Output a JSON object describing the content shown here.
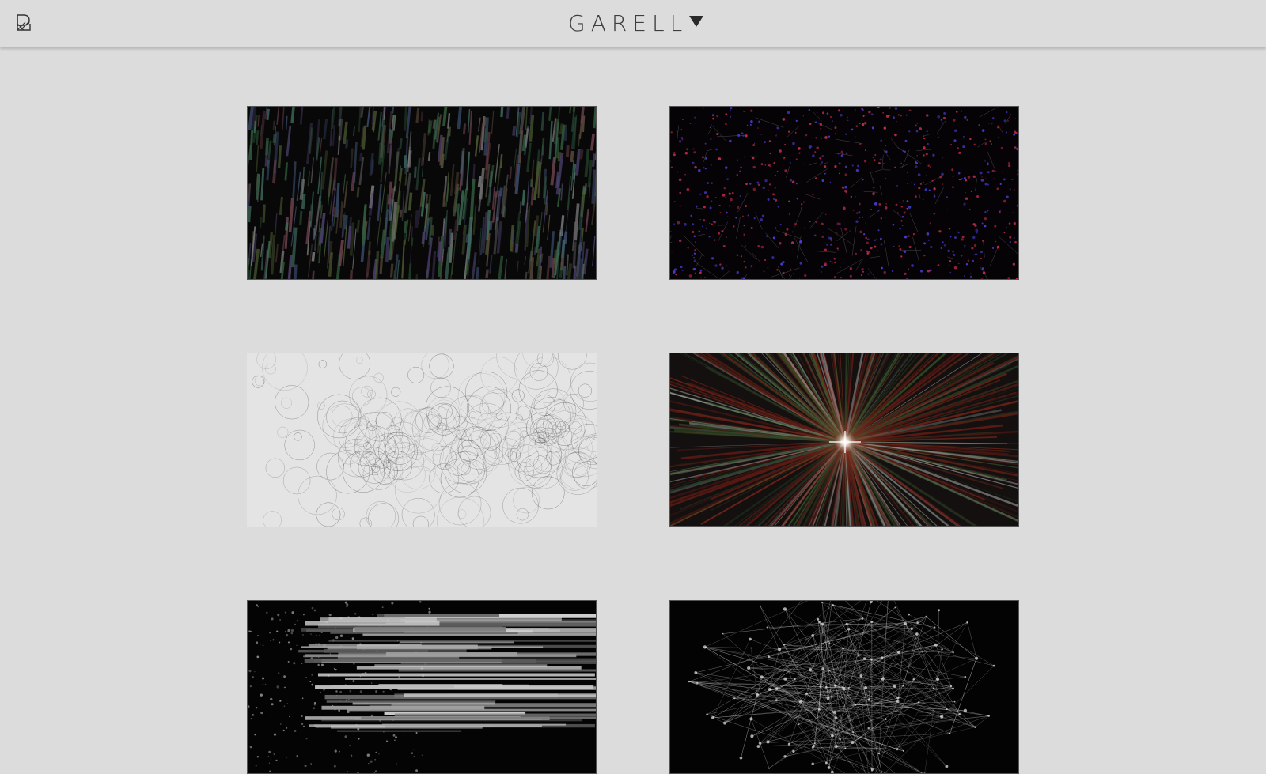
{
  "header": {
    "brand_text": "GARELL",
    "menu_icon": "gallery-logo-icon",
    "brand_mark_icon": "triangle-down-icon"
  },
  "gallery": {
    "items": [
      {
        "style": "vertical colored streaks on black",
        "accent": "#3a5a3a"
      },
      {
        "style": "red and blue particles on black",
        "accent": "#b03050"
      },
      {
        "style": "grey circular scribbles on light grey",
        "accent": "#8a8a8a"
      },
      {
        "style": "red green starburst with bright center",
        "accent": "#8a2a1a"
      },
      {
        "style": "horizontal grey bars on black",
        "accent": "#9a9a9a"
      },
      {
        "style": "white network mesh on black",
        "accent": "#e0e0e0"
      }
    ]
  },
  "colors": {
    "background": "#dcdcdc",
    "text": "#3e3e3e"
  }
}
